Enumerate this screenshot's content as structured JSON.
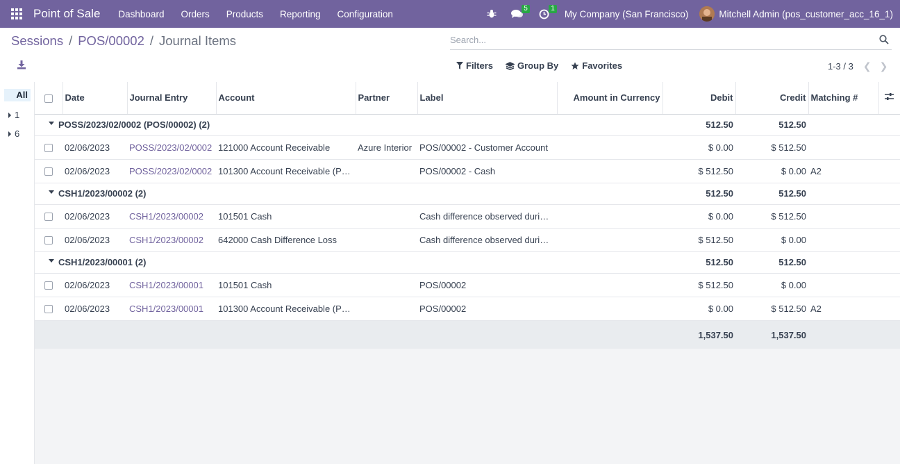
{
  "app": {
    "title": "Point of Sale",
    "menu": [
      "Dashboard",
      "Orders",
      "Products",
      "Reporting",
      "Configuration"
    ],
    "messages_count": "5",
    "activities_count": "1",
    "company": "My Company (San Francisco)",
    "user": "Mitchell Admin (pos_customer_acc_16_1)",
    "accent_color": "#71639e"
  },
  "breadcrumb": {
    "items": [
      "Sessions",
      "POS/00002"
    ],
    "separator": "/",
    "current": "Journal Items"
  },
  "search": {
    "placeholder": "Search..."
  },
  "filters": {
    "filters_label": "Filters",
    "groupby_label": "Group By",
    "favorites_label": "Favorites"
  },
  "pager": {
    "text": "1-3 / 3"
  },
  "side_panel": {
    "all_label": "All",
    "items": [
      "1",
      "6"
    ]
  },
  "table": {
    "columns": [
      "Date",
      "Journal Entry",
      "Account",
      "Partner",
      "Label",
      "Amount in Currency",
      "Debit",
      "Credit",
      "Matching #"
    ],
    "groups": [
      {
        "title": "POSS/2023/02/0002 (POS/00002) (2)",
        "debit": "512.50",
        "credit": "512.50",
        "rows": [
          {
            "date": "02/06/2023",
            "entry": "POSS/2023/02/0002",
            "account": "121000 Account Receivable",
            "partner": "Azure Interior",
            "label": "POS/00002 - Customer Account",
            "amount_currency": "",
            "debit": "$ 0.00",
            "credit": "$ 512.50",
            "matching": ""
          },
          {
            "date": "02/06/2023",
            "entry": "POSS/2023/02/0002",
            "account": "101300 Account Receivable (P…",
            "partner": "",
            "label": "POS/00002 - Cash",
            "amount_currency": "",
            "debit": "$ 512.50",
            "credit": "$ 0.00",
            "matching": "A2"
          }
        ]
      },
      {
        "title": "CSH1/2023/00002 (2)",
        "debit": "512.50",
        "credit": "512.50",
        "rows": [
          {
            "date": "02/06/2023",
            "entry": "CSH1/2023/00002",
            "account": "101501 Cash",
            "partner": "",
            "label": "Cash difference observed duri…",
            "amount_currency": "",
            "debit": "$ 0.00",
            "credit": "$ 512.50",
            "matching": ""
          },
          {
            "date": "02/06/2023",
            "entry": "CSH1/2023/00002",
            "account": "642000 Cash Difference Loss",
            "partner": "",
            "label": "Cash difference observed duri…",
            "amount_currency": "",
            "debit": "$ 512.50",
            "credit": "$ 0.00",
            "matching": ""
          }
        ]
      },
      {
        "title": "CSH1/2023/00001 (2)",
        "debit": "512.50",
        "credit": "512.50",
        "rows": [
          {
            "date": "02/06/2023",
            "entry": "CSH1/2023/00001",
            "account": "101501 Cash",
            "partner": "",
            "label": "POS/00002",
            "amount_currency": "",
            "debit": "$ 512.50",
            "credit": "$ 0.00",
            "matching": ""
          },
          {
            "date": "02/06/2023",
            "entry": "CSH1/2023/00001",
            "account": "101300 Account Receivable (P…",
            "partner": "",
            "label": "POS/00002",
            "amount_currency": "",
            "debit": "$ 0.00",
            "credit": "$ 512.50",
            "matching": "A2"
          }
        ]
      }
    ],
    "totals": {
      "debit": "1,537.50",
      "credit": "1,537.50"
    }
  }
}
